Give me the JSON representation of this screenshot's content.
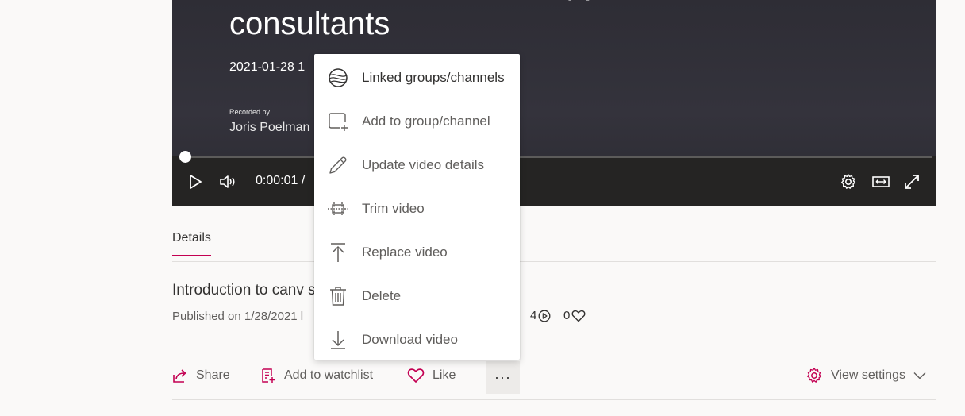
{
  "player": {
    "title": "Introduction to canvas apps for CRM\nconsultants",
    "date": "2021-01-28 1",
    "recorded_by_label": "Recorded by",
    "recorded_by_name": "Joris Poelman",
    "current_time": "0:00:01  /"
  },
  "tabs": {
    "details": "Details"
  },
  "video_info": {
    "title": "Introduction to canv                                    s",
    "published": "Published on 1/28/2021 l",
    "views": "4",
    "likes": "0"
  },
  "actions": {
    "share": "Share",
    "watchlist": "Add to watchlist",
    "like": "Like",
    "more": "···",
    "view_settings": "View settings"
  },
  "menu": {
    "items": [
      {
        "label": "Linked groups/channels",
        "icon": "globe-icon"
      },
      {
        "label": "Add to group/channel",
        "icon": "add-to-group-icon"
      },
      {
        "label": "Update video details",
        "icon": "pencil-icon"
      },
      {
        "label": "Trim video",
        "icon": "trim-icon"
      },
      {
        "label": "Replace video",
        "icon": "replace-upload-icon"
      },
      {
        "label": "Delete",
        "icon": "trash-icon"
      },
      {
        "label": "Download video",
        "icon": "download-icon"
      }
    ]
  },
  "colors": {
    "accent": "#c30052",
    "player_bg": "#34333c",
    "controls_bg": "#252423",
    "menu_bg": "#ffffff",
    "page_bg": "#faf9f8"
  }
}
